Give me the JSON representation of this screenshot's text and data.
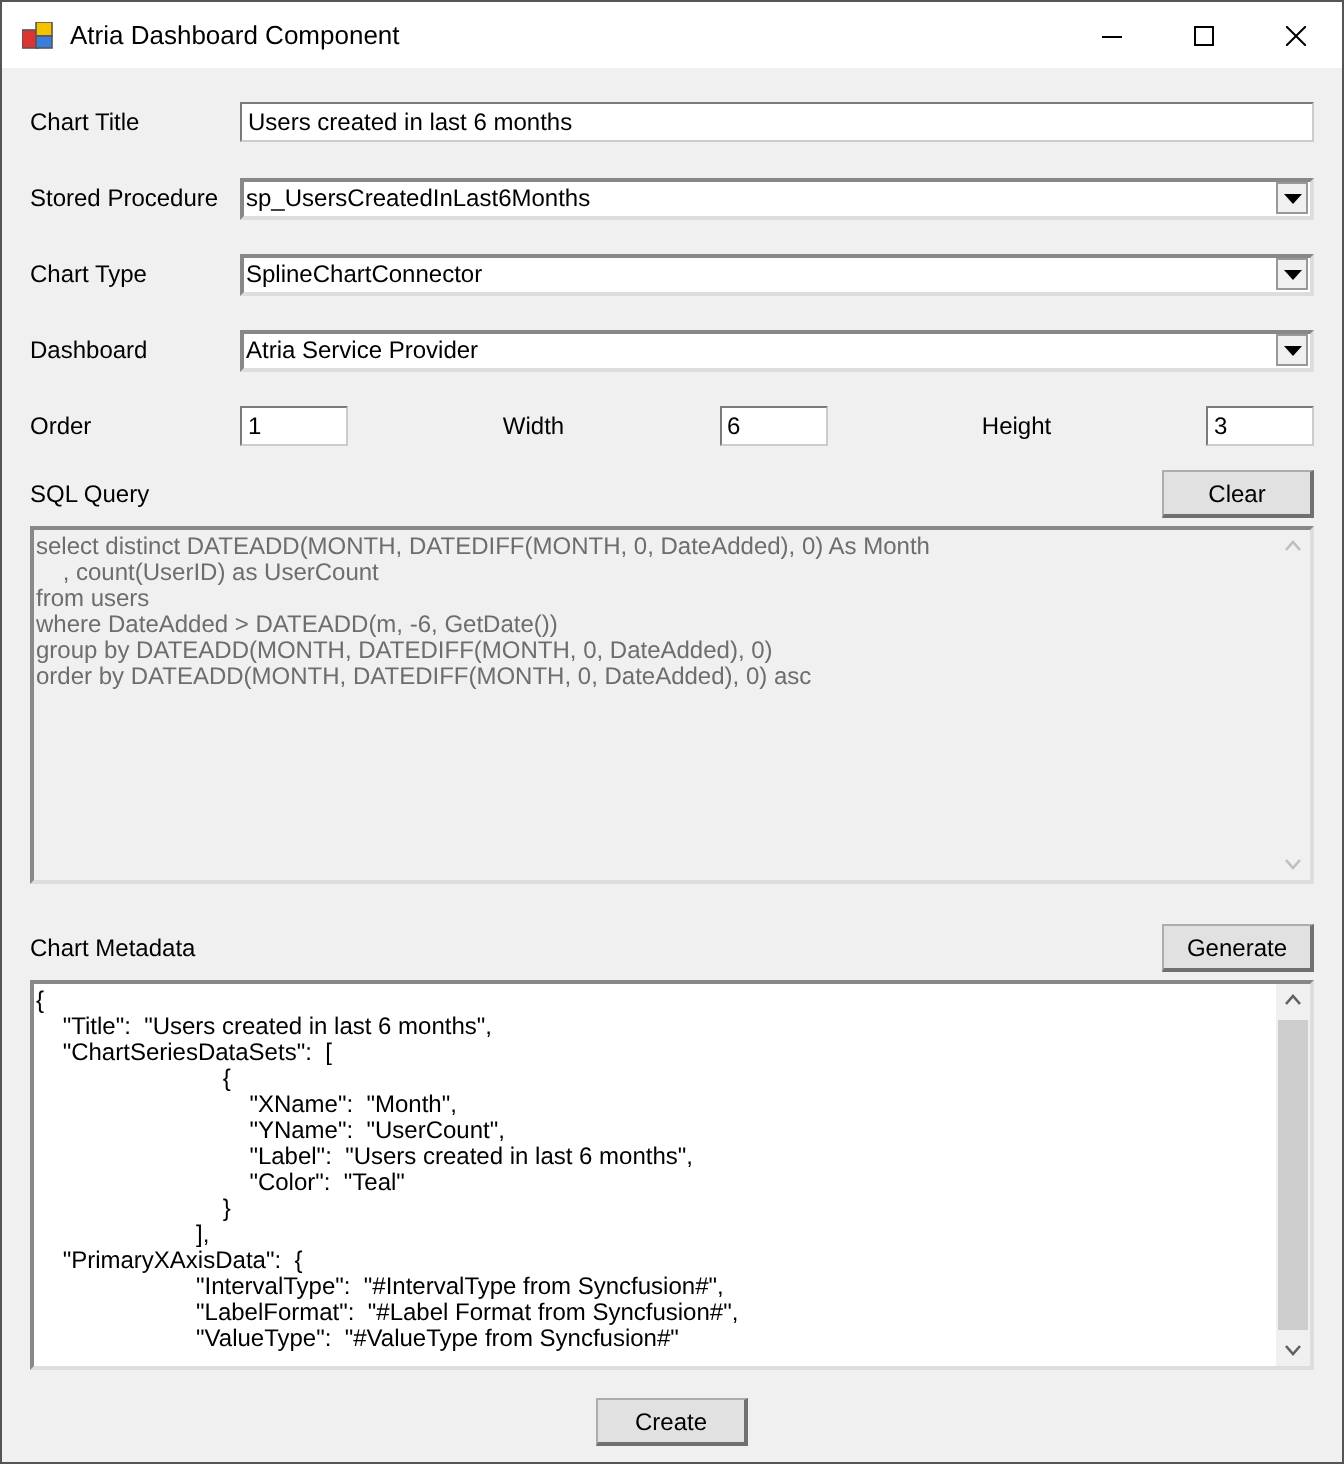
{
  "window": {
    "title": "Atria Dashboard Component"
  },
  "fields": [
    {
      "kind": "text",
      "label": "Chart Title",
      "value": "Users created in last 6 months"
    },
    {
      "kind": "dropdown",
      "label": "Stored Procedure",
      "value": "sp_UsersCreatedInLast6Months"
    },
    {
      "kind": "dropdown",
      "label": "Chart Type",
      "value": "SplineChartConnector"
    },
    {
      "kind": "dropdown",
      "label": "Dashboard",
      "value": "Atria Service Provider"
    }
  ],
  "layout": [
    {
      "label": "Order",
      "value": "1"
    },
    {
      "label": "Width",
      "value": "6"
    },
    {
      "label": "Height",
      "value": "3"
    }
  ],
  "sql_query": {
    "label": "SQL Query",
    "button": "Clear",
    "disabled": true,
    "value": "select distinct DATEADD(MONTH, DATEDIFF(MONTH, 0, DateAdded), 0) As Month\n    , count(UserID) as UserCount\nfrom users\nwhere DateAdded > DATEADD(m, -6, GetDate())\ngroup by DATEADD(MONTH, DATEDIFF(MONTH, 0, DateAdded), 0)\norder by DATEADD(MONTH, DATEDIFF(MONTH, 0, DateAdded), 0) asc"
  },
  "chart_metadata": {
    "label": "Chart Metadata",
    "button": "Generate",
    "disabled": false,
    "value": "{\n    \"Title\":  \"Users created in last 6 months\",\n    \"ChartSeriesDataSets\":  [\n                            {\n                                \"XName\":  \"Month\",\n                                \"YName\":  \"UserCount\",\n                                \"Label\":  \"Users created in last 6 months\",\n                                \"Color\":  \"Teal\"\n                            }\n                        ],\n    \"PrimaryXAxisData\":  {\n                        \"IntervalType\":  \"#IntervalType from Syncfusion#\",\n                        \"LabelFormat\":  \"#Label Format from Syncfusion#\",\n                        \"ValueType\":  \"#ValueType from Syncfusion#\""
  },
  "footer": {
    "button": "Create"
  }
}
